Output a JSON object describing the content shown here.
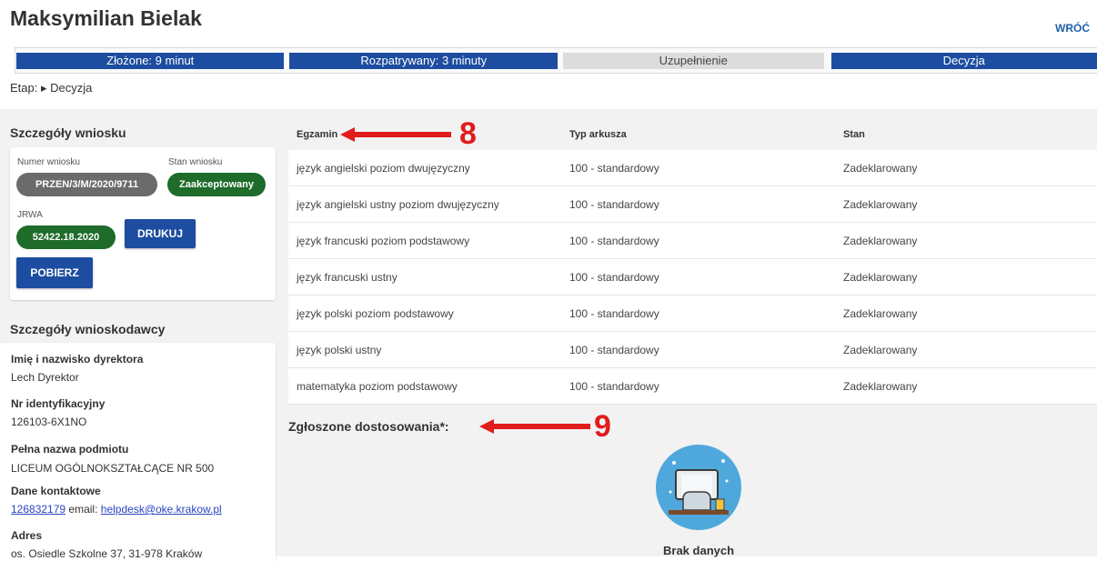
{
  "header": {
    "title": "Maksymilian Bielak",
    "back_label": "WRÓĆ"
  },
  "progress": {
    "steps": [
      {
        "label": "Złożone: 9 minut",
        "state": "done"
      },
      {
        "label": "Rozpatrywany: 3 minuty",
        "state": "done"
      },
      {
        "label": "Uzupełnienie",
        "state": "skipped"
      },
      {
        "label": "Decyzja",
        "state": "current"
      }
    ],
    "stage_text": "Etap: ▸ Decyzja"
  },
  "request": {
    "section_title": "Szczegóły wniosku",
    "number_label": "Numer wniosku",
    "number_value": "PRZEN/3/M/2020/9711",
    "status_label": "Stan wniosku",
    "status_value": "Zaakceptowany",
    "jrwa_label": "JRWA",
    "jrwa_value": "52422.18.2020",
    "print_button": "DRUKUJ",
    "download_button": "POBIERZ"
  },
  "applicant": {
    "section_title": "Szczegóły wnioskodawcy",
    "director_label": "Imię i nazwisko dyrektora",
    "director_value": "Lech Dyrektor",
    "id_label": "Nr identyfikacyjny",
    "id_value": "126103-6X1NO",
    "entity_label": "Pełna nazwa podmiotu",
    "entity_value": "LICEUM OGÓLNOKSZTAŁCĄCE NR 500",
    "contact_label": "Dane kontaktowe",
    "contact_phone": "126832179",
    "contact_email_prefix": "email:",
    "contact_email": "helpdesk@oke.krakow.pl",
    "address_label": "Adres",
    "address_value": "os. Osiedle Szkolne 37, 31-978 Kraków"
  },
  "exams_table": {
    "columns": [
      "Egzamin",
      "Typ arkusza",
      "Stan"
    ],
    "rows": [
      [
        "język angielski poziom dwujęzyczny",
        "100 - standardowy",
        "Zadeklarowany"
      ],
      [
        "język angielski ustny poziom dwujęzyczny",
        "100 - standardowy",
        "Zadeklarowany"
      ],
      [
        "język francuski poziom podstawowy",
        "100 - standardowy",
        "Zadeklarowany"
      ],
      [
        "język francuski ustny",
        "100 - standardowy",
        "Zadeklarowany"
      ],
      [
        "język polski poziom podstawowy",
        "100 - standardowy",
        "Zadeklarowany"
      ],
      [
        "język polski ustny",
        "100 - standardowy",
        "Zadeklarowany"
      ],
      [
        "matematyka poziom podstawowy",
        "100 - standardowy",
        "Zadeklarowany"
      ]
    ]
  },
  "annotations": {
    "marker_8": "8",
    "marker_9": "9"
  },
  "adjustments": {
    "title": "Zgłoszone dostosowania*:",
    "empty_text": "Brak danych"
  },
  "colors": {
    "primary_blue": "#1c4da0",
    "pill_green": "#1e6b2a",
    "pill_gray": "#6b6b6b",
    "annotation_red": "#e01c1c",
    "icon_circle": "#4fa8dc"
  }
}
